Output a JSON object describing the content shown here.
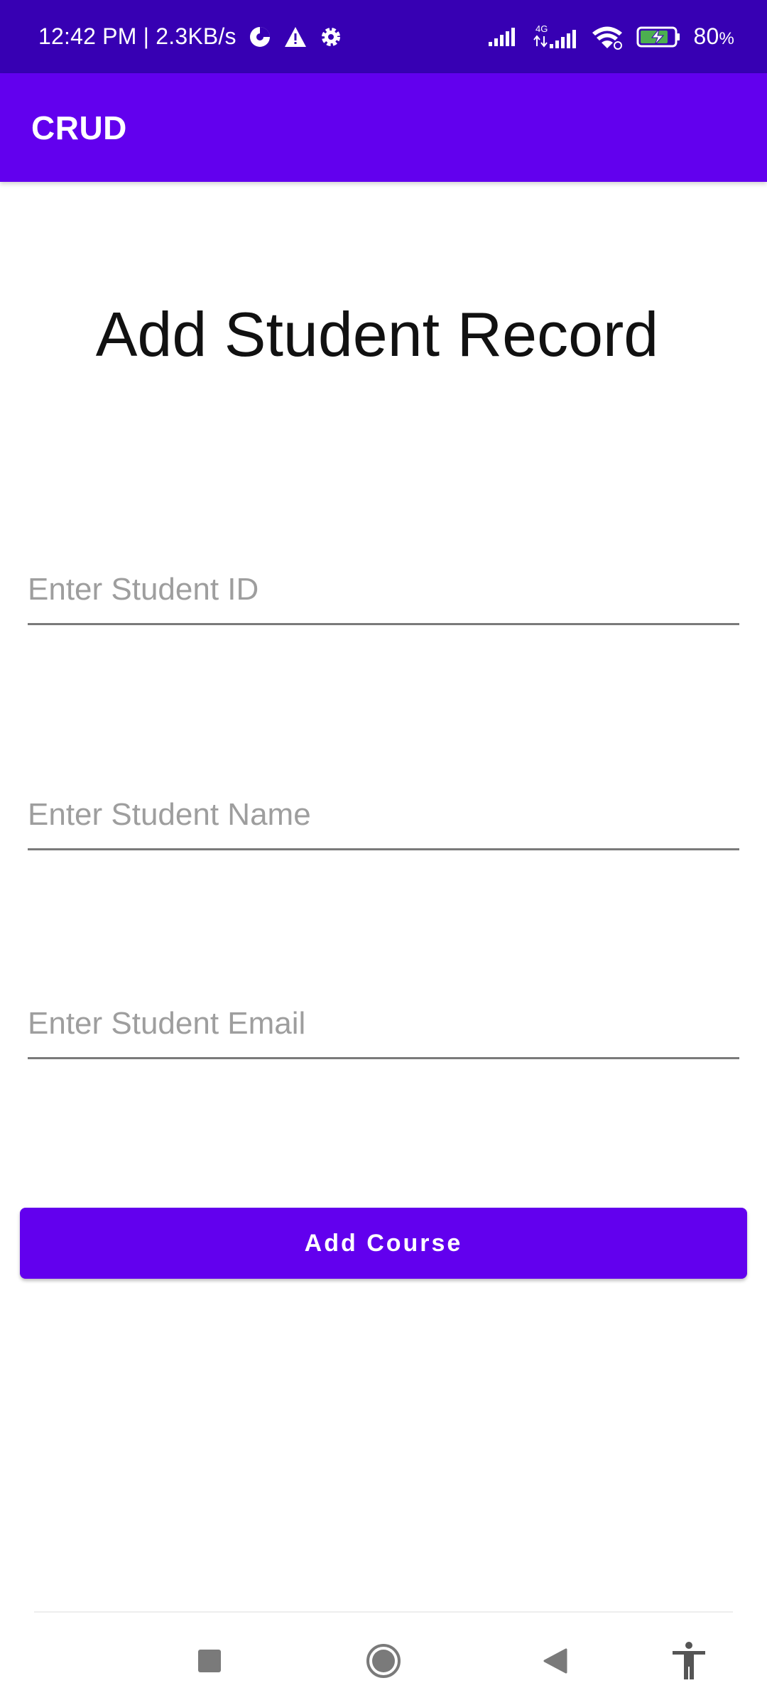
{
  "status_bar": {
    "time_speed": "12:42 PM | 2.3KB/s",
    "network_type": "4G",
    "battery_percent": "80",
    "battery_unit": "%"
  },
  "app_bar": {
    "title": "CRUD"
  },
  "main": {
    "heading": "Add Student Record",
    "fields": {
      "student_id_placeholder": "Enter Student ID",
      "student_name_placeholder": "Enter Student Name",
      "student_email_placeholder": "Enter Student Email"
    },
    "add_button_label": "Add Course"
  },
  "colors": {
    "status_bar": "#3700b3",
    "primary": "#6200ee"
  },
  "icons": {
    "status_left": [
      "data-saver-icon",
      "warning-icon",
      "settings-icon"
    ],
    "status_right": [
      "signal-icon",
      "signal-4g-icon",
      "wifi-icon",
      "battery-charging-icon"
    ],
    "nav": [
      "recents-square-icon",
      "home-circle-icon",
      "back-triangle-icon",
      "accessibility-icon"
    ]
  }
}
